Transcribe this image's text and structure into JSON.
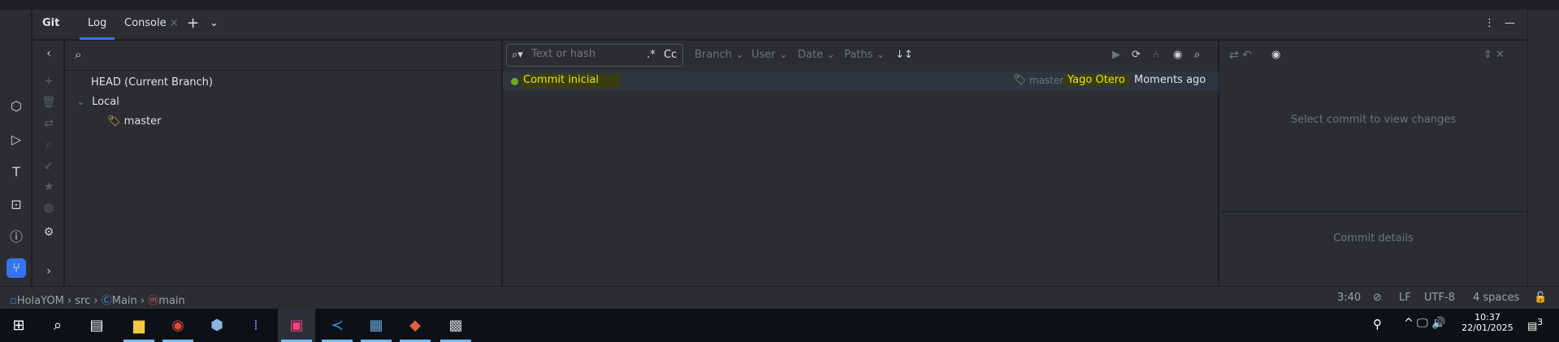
{
  "header": {
    "title": "Git",
    "tabs": [
      {
        "label": "Log",
        "active": true
      },
      {
        "label": "Console",
        "active": false
      }
    ]
  },
  "tree": {
    "items": [
      {
        "label": "HEAD (Current Branch)"
      },
      {
        "label": "Local",
        "expanded": true
      },
      {
        "label": "master"
      }
    ]
  },
  "log": {
    "search_placeholder": "Text or hash",
    "regex_label": ".*",
    "case_label": "Cc",
    "filters": [
      "Branch",
      "User",
      "Date",
      "Paths"
    ],
    "commits": [
      {
        "message": "Commit inicial",
        "branch": "master",
        "author": "Yago Otero",
        "date": "Moments ago"
      }
    ]
  },
  "details": {
    "empty_changes": "Select commit to view changes",
    "empty_details": "Commit details"
  },
  "status": {
    "breadcrumb": [
      "HolaYOM",
      "src",
      "Main",
      "main"
    ],
    "position": "3:40",
    "line_ending": "LF",
    "encoding": "UTF-8",
    "indent": "4 spaces"
  },
  "taskbar": {
    "time": "10:37",
    "date": "22/01/2025",
    "notifications": "3"
  },
  "colors": {
    "accent": "#3574f0",
    "highlight": "#e6e600",
    "commit_dot": "#6aab1e",
    "tag": "#f2c55c"
  }
}
